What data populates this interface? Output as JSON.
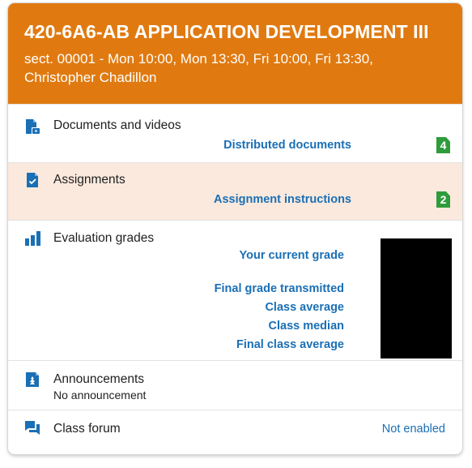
{
  "colors": {
    "header_bg": "#e07a10",
    "highlight_bg": "#fbe9dd",
    "link": "#1a6fb5",
    "icon_blue": "#1a6fb5",
    "badge_green": "#2f9c3b"
  },
  "course": {
    "title": "420-6A6-AB APPLICATION DEVELOPMENT III",
    "subtitle": "sect. 00001 - Mon 10:00, Mon 13:30, Fri 10:00, Fri 13:30, Christopher Chadillon"
  },
  "documents": {
    "icon": "document-video-icon",
    "title": "Documents and videos",
    "link": "Distributed documents",
    "count": "4"
  },
  "assignments": {
    "icon": "assignment-check-icon",
    "title": "Assignments",
    "link": "Assignment instructions",
    "count": "2"
  },
  "grades": {
    "icon": "bar-chart-icon",
    "title": "Evaluation grades",
    "current": "Your current grade",
    "final_transmitted": "Final grade transmitted",
    "class_average": "Class average",
    "class_median": "Class median",
    "final_class_average": "Final class average"
  },
  "announcements": {
    "icon": "announcement-icon",
    "title": "Announcements",
    "status": "No announcement"
  },
  "forum": {
    "icon": "chat-bubbles-icon",
    "title": "Class forum",
    "status": "Not enabled"
  }
}
